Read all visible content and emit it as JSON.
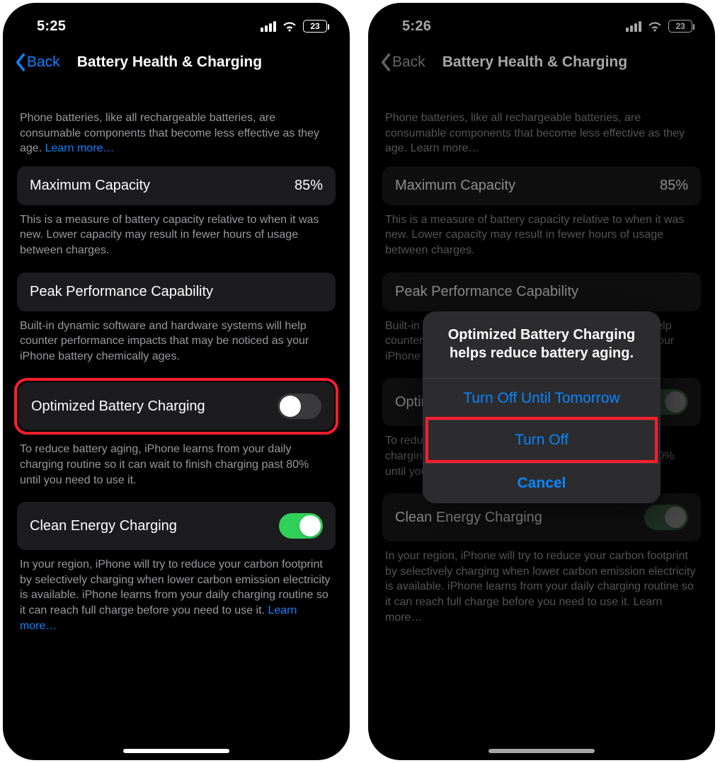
{
  "left": {
    "status": {
      "time": "5:25",
      "battery": "23"
    },
    "nav": {
      "back": "Back",
      "title": "Battery Health & Charging"
    },
    "intro": {
      "text": "Phone batteries, like all rechargeable batteries, are consumable components that become less effective as they age. ",
      "learn_more": "Learn more…"
    },
    "max_capacity": {
      "label": "Maximum Capacity",
      "value": "85%",
      "note": "This is a measure of battery capacity relative to when it was new. Lower capacity may result in fewer hours of usage between charges."
    },
    "peak": {
      "label": "Peak Performance Capability",
      "note": "Built-in dynamic software and hardware systems will help counter performance impacts that may be noticed as your iPhone battery chemically ages."
    },
    "optimized": {
      "label": "Optimized Battery Charging",
      "note": "To reduce battery aging, iPhone learns from your daily charging routine so it can wait to finish charging past 80% until you need to use it."
    },
    "clean": {
      "label": "Clean Energy Charging",
      "note_pre": "In your region, iPhone will try to reduce your carbon footprint by selectively charging when lower carbon emission electricity is available. iPhone learns from your daily charging routine so it can reach full charge before you need to use it. ",
      "learn_more": "Learn more…"
    }
  },
  "right": {
    "status": {
      "time": "5:26",
      "battery": "23"
    },
    "nav": {
      "back": "Back",
      "title": "Battery Health & Charging"
    },
    "intro": {
      "text": "Phone batteries, like all rechargeable batteries, are consumable components that become less effective as they age. ",
      "learn_more": "Learn more…"
    },
    "max_capacity": {
      "label": "Maximum Capacity",
      "value": "85%",
      "note": "This is a measure of battery capacity relative to when it was new. Lower capacity may result in fewer hours of usage between charges."
    },
    "peak": {
      "label": "Peak Performance Capability",
      "note": "Built-in dynamic software and hardware systems will help counter performance impacts that may be noticed as your iPhone battery chemically ages."
    },
    "optimized": {
      "label": "Optimized Battery Charging",
      "note": "To reduce battery aging, iPhone learns from your daily charging routine so it can wait to finish charging past 80% until you need to use it."
    },
    "clean": {
      "label": "Clean Energy Charging",
      "note_pre": "In your region, iPhone will try to reduce your carbon footprint by selectively charging when lower carbon emission electricity is available. iPhone learns from your daily charging routine so it can reach full charge before you need to use it. ",
      "learn_more": "Learn more…"
    },
    "sheet": {
      "title": "Optimized Battery Charging helps reduce battery aging.",
      "opt_tomorrow": "Turn Off Until Tomorrow",
      "opt_off": "Turn Off",
      "cancel": "Cancel"
    }
  }
}
